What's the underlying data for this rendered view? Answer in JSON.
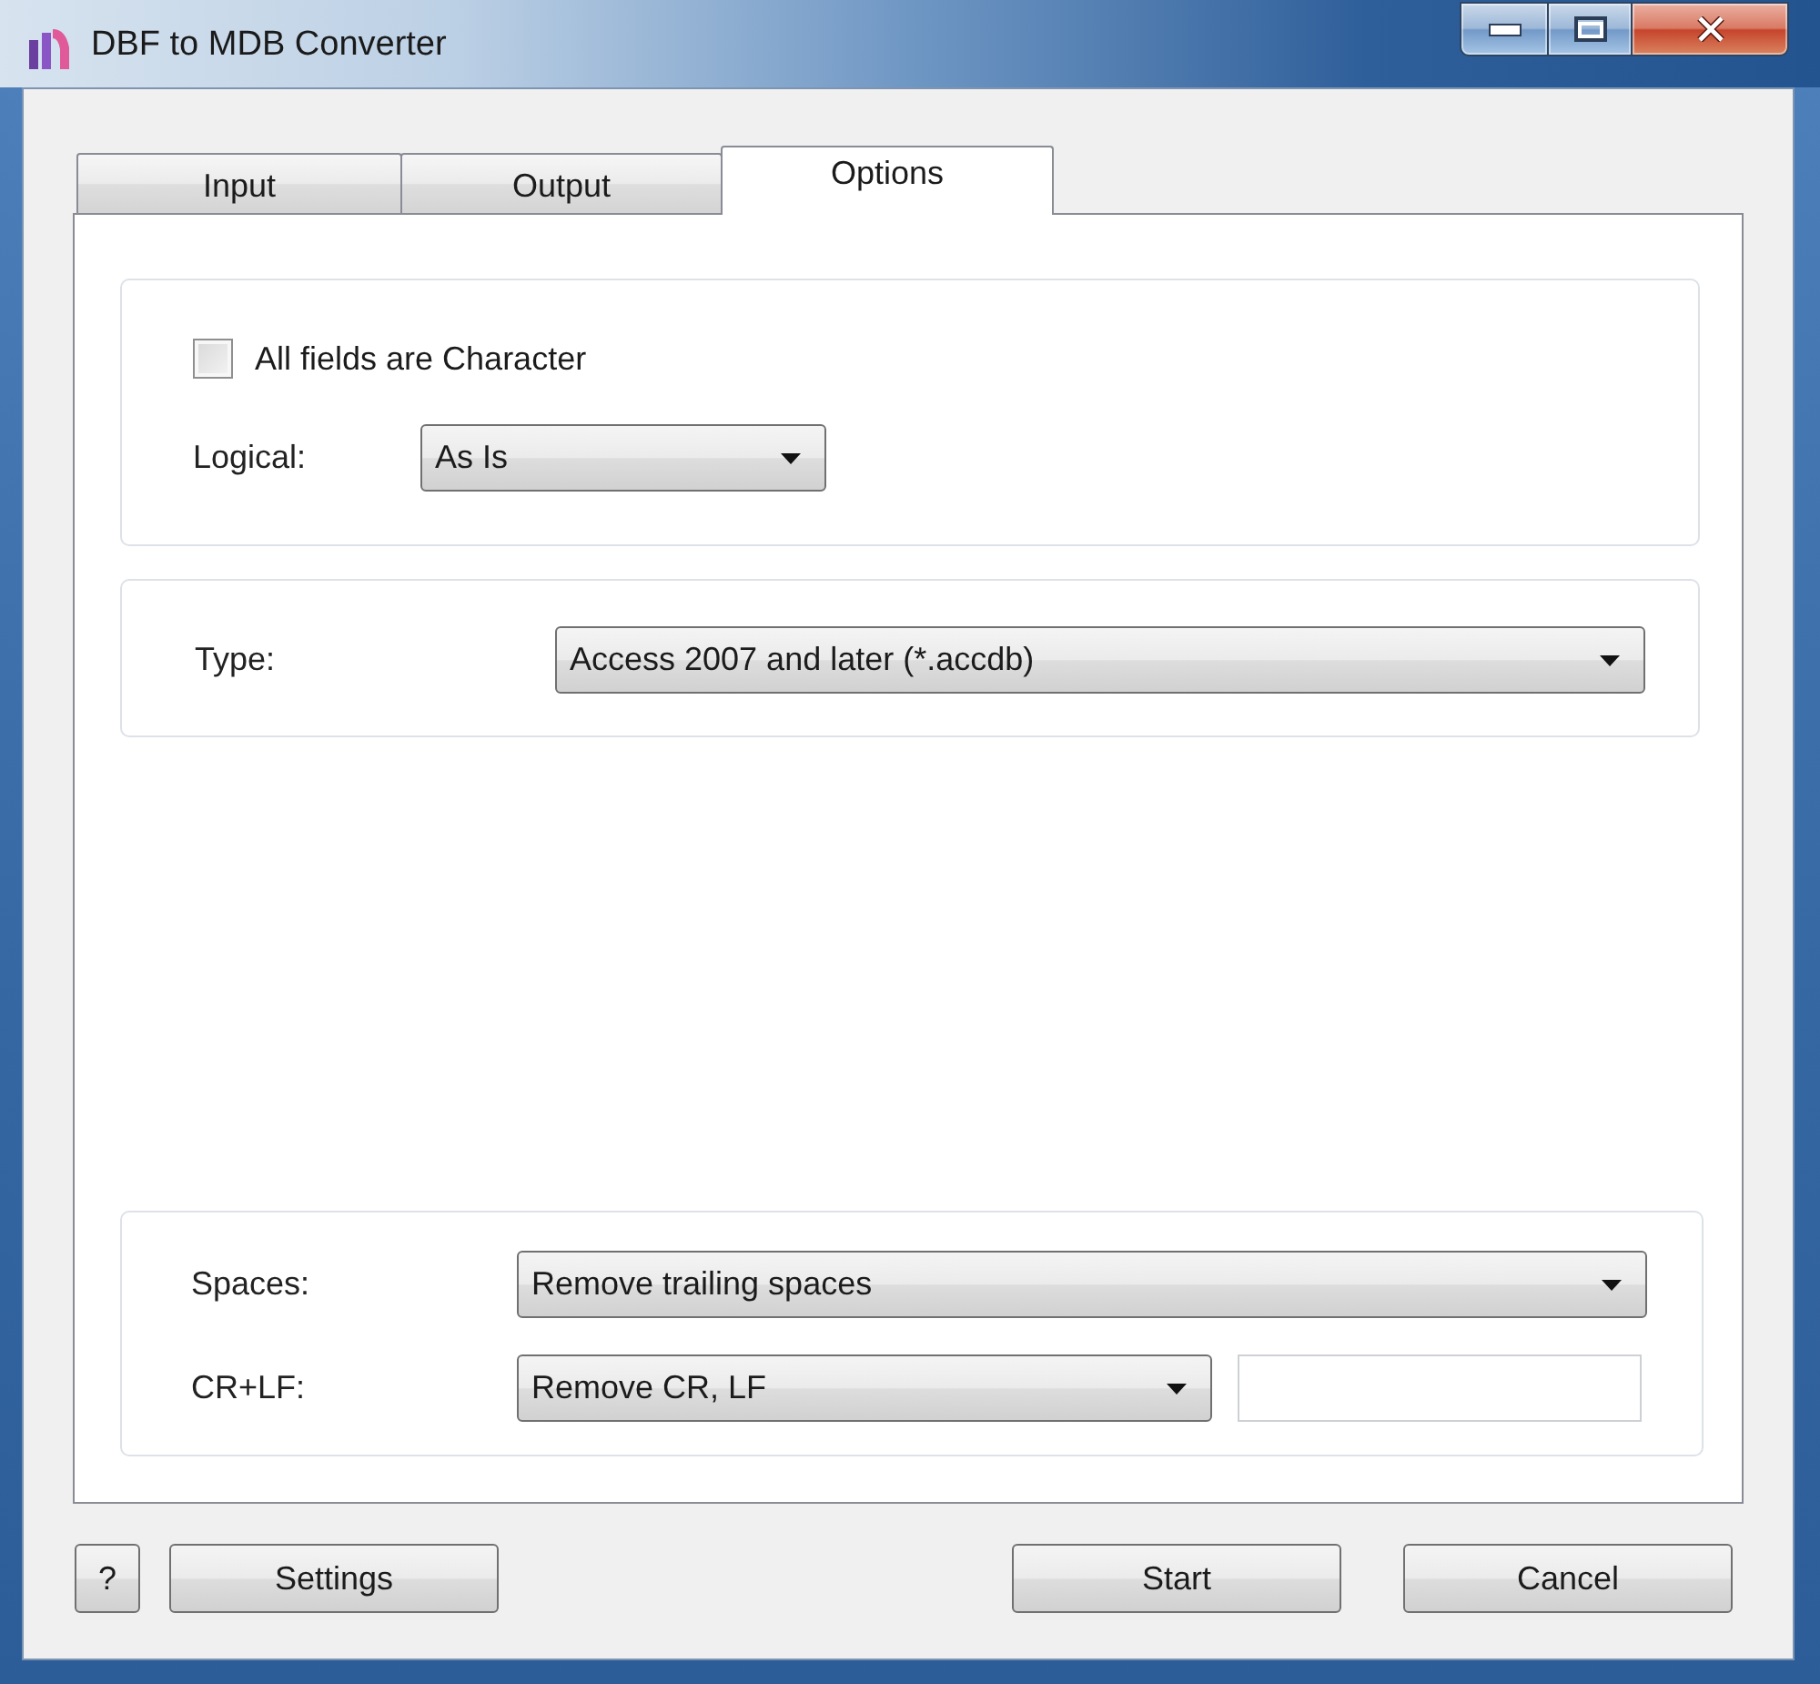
{
  "window": {
    "title": "DBF to MDB Converter"
  },
  "tabs": [
    {
      "label": "Input",
      "selected": false
    },
    {
      "label": "Output",
      "selected": false
    },
    {
      "label": "Options",
      "selected": true
    }
  ],
  "groups": [
    {
      "rows": [
        {
          "kind": "checkbox",
          "label": "All fields are Character",
          "checked": false
        },
        {
          "kind": "dropdown",
          "label": "Logical:",
          "value": "As Is"
        }
      ]
    },
    {
      "rows": [
        {
          "kind": "dropdown",
          "label": "Type:",
          "value": "Access 2007 and later (*.accdb)"
        }
      ]
    },
    {
      "rows": [
        {
          "kind": "dropdown",
          "label": "Spaces:",
          "value": "Remove trailing spaces"
        },
        {
          "kind": "dropdown-with-field",
          "label": "CR+LF:",
          "value": "Remove CR, LF"
        }
      ]
    }
  ],
  "footer": {
    "left": [
      "?",
      "Settings"
    ],
    "right": [
      "Start",
      "Cancel"
    ]
  }
}
